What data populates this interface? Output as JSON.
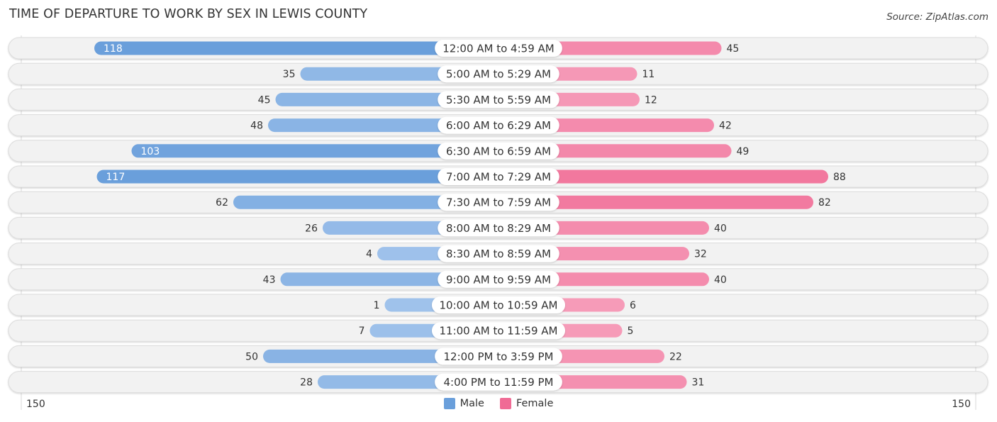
{
  "title": "TIME OF DEPARTURE TO WORK BY SEX IN LEWIS COUNTY",
  "source": "Source: ZipAtlas.com",
  "colors": {
    "male": "#6a9fdb",
    "female": "#f06b95",
    "male_light": "#a9c8ee",
    "female_light": "#f7a6c0",
    "track": "#f2f2f2"
  },
  "chart_data": {
    "type": "bar",
    "orientation": "horizontal-diverging",
    "title": "TIME OF DEPARTURE TO WORK BY SEX IN LEWIS COUNTY",
    "categories": [
      "12:00 AM to 4:59 AM",
      "5:00 AM to 5:29 AM",
      "5:30 AM to 5:59 AM",
      "6:00 AM to 6:29 AM",
      "6:30 AM to 6:59 AM",
      "7:00 AM to 7:29 AM",
      "7:30 AM to 7:59 AM",
      "8:00 AM to 8:29 AM",
      "8:30 AM to 8:59 AM",
      "9:00 AM to 9:59 AM",
      "10:00 AM to 10:59 AM",
      "11:00 AM to 11:59 AM",
      "12:00 PM to 3:59 PM",
      "4:00 PM to 11:59 PM"
    ],
    "series": [
      {
        "name": "Male",
        "values": [
          118,
          35,
          45,
          48,
          103,
          117,
          62,
          26,
          4,
          43,
          1,
          7,
          50,
          28
        ]
      },
      {
        "name": "Female",
        "values": [
          45,
          11,
          12,
          42,
          49,
          88,
          82,
          40,
          32,
          40,
          6,
          5,
          22,
          31
        ]
      }
    ],
    "axis": {
      "left_label": "150",
      "right_label": "150",
      "max": 150
    },
    "legend": {
      "position": "bottom-center",
      "entries": [
        "Male",
        "Female"
      ]
    },
    "grid": false
  }
}
